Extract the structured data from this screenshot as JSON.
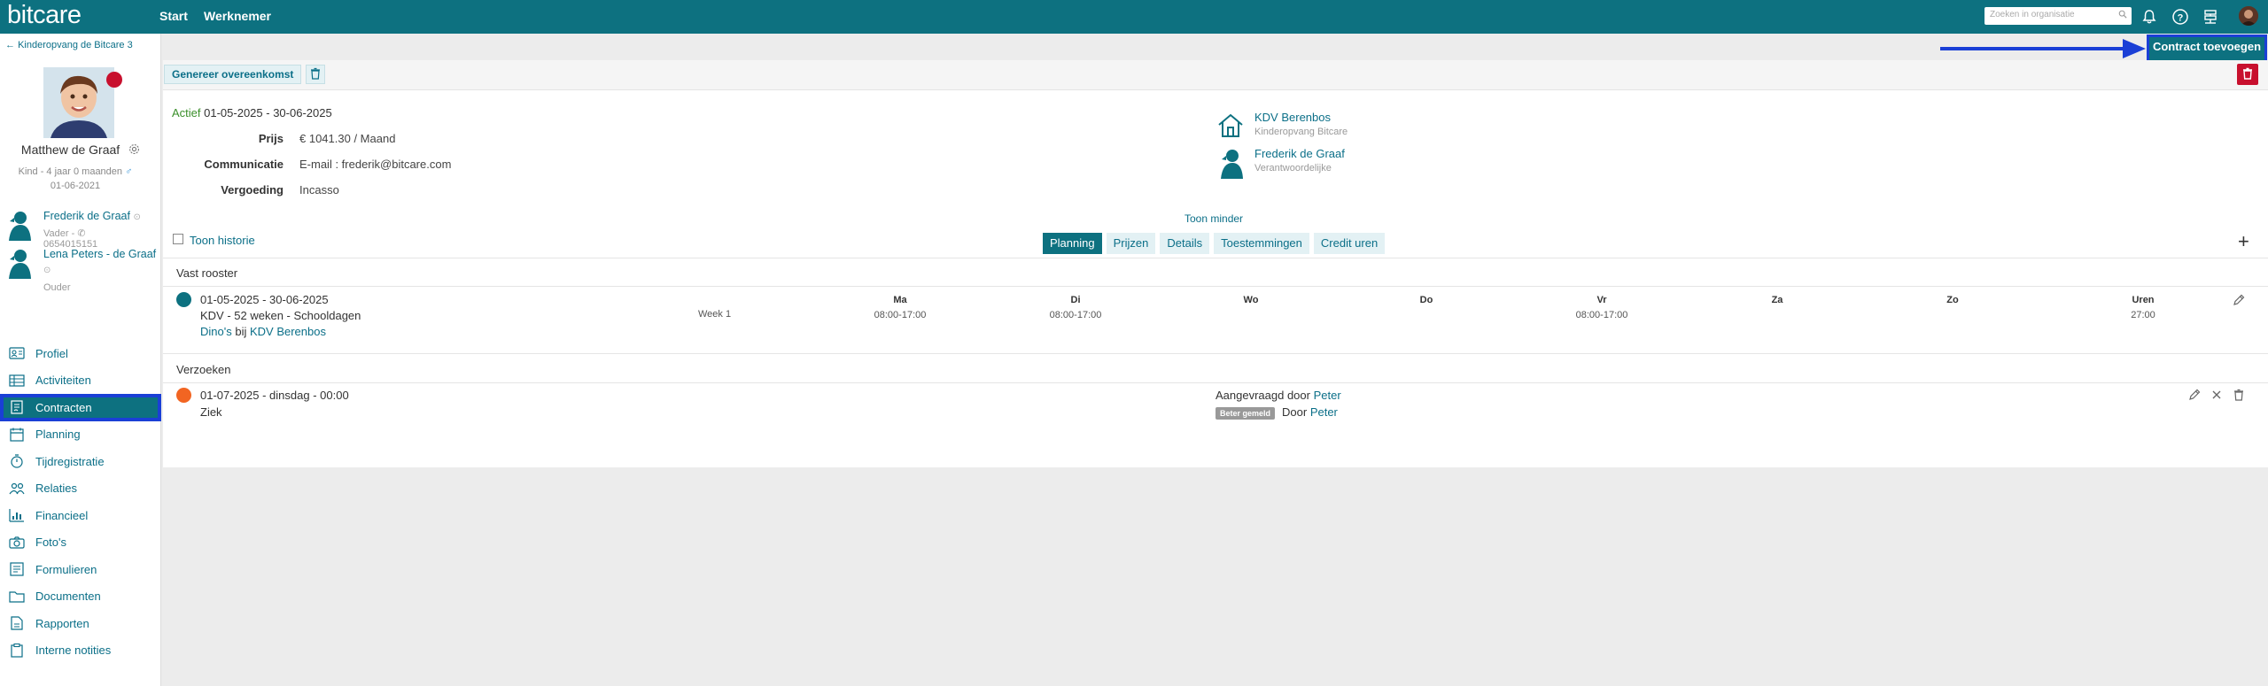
{
  "topbar": {
    "logo": "bitcare",
    "nav": [
      "Start",
      "Werknemer"
    ],
    "search_placeholder": "Zoeken in organisatie"
  },
  "sidebar": {
    "back_link": "Kinderopvang de Bitcare 3",
    "child": {
      "name": "Matthew de Graaf",
      "subtitle": "Kind - 4 jaar 0 maanden",
      "birthdate": "01-06-2021"
    },
    "relations": [
      {
        "name": "Frederik de Graaf",
        "role": "Vader - ",
        "phone": "0654015151"
      },
      {
        "name": "Lena Peters - de Graaf",
        "role": "Ouder",
        "phone": ""
      }
    ],
    "menu": [
      {
        "label": "Profiel",
        "icon": "profile-card-icon",
        "active": false
      },
      {
        "label": "Activiteiten",
        "icon": "table-icon",
        "active": false
      },
      {
        "label": "Contracten",
        "icon": "contract-icon",
        "active": true
      },
      {
        "label": "Planning",
        "icon": "calendar-icon",
        "active": false
      },
      {
        "label": "Tijdregistratie",
        "icon": "stopwatch-icon",
        "active": false
      },
      {
        "label": "Relaties",
        "icon": "people-icon",
        "active": false
      },
      {
        "label": "Financieel",
        "icon": "bar-chart-icon",
        "active": false
      },
      {
        "label": "Foto's",
        "icon": "camera-icon",
        "active": false
      },
      {
        "label": "Formulieren",
        "icon": "form-icon",
        "active": false
      },
      {
        "label": "Documenten",
        "icon": "folder-icon",
        "active": false
      },
      {
        "label": "Rapporten",
        "icon": "report-icon",
        "active": false
      },
      {
        "label": "Interne notities",
        "icon": "clipboard-icon",
        "active": false
      }
    ]
  },
  "actions": {
    "generate_label": "Genereer overeenkomst",
    "add_contract_label": "Contract toevoegen"
  },
  "contract": {
    "status": "Actief",
    "period": "01-05-2025 - 30-06-2025",
    "fields": [
      {
        "key": "Prijs",
        "value": "€ 1041.30 / Maand"
      },
      {
        "key": "Communicatie",
        "value": "E-mail : frederik@bitcare.com"
      },
      {
        "key": "Vergoeding",
        "value": "Incasso"
      }
    ],
    "location": {
      "name": "KDV Berenbos",
      "sub": "Kinderopvang Bitcare"
    },
    "responsible": {
      "name": "Frederik de Graaf",
      "sub": "Verantwoordelijke"
    },
    "toggle_less": "Toon minder"
  },
  "history_toggle": "Toon historie",
  "tabs": [
    {
      "label": "Planning",
      "active": true
    },
    {
      "label": "Prijzen",
      "active": false
    },
    {
      "label": "Details",
      "active": false
    },
    {
      "label": "Toestemmingen",
      "active": false
    },
    {
      "label": "Credit uren",
      "active": false
    }
  ],
  "schedule": {
    "heading": "Vast rooster",
    "color": "#0d7180",
    "period": "01-05-2025 - 30-06-2025",
    "name": "KDV - 52 weken - Schooldagen",
    "group": "Dino's",
    "at": "bij",
    "location": "KDV Berenbos",
    "week": "Week 1",
    "days": [
      {
        "label": "Ma",
        "value": "08:00-17:00"
      },
      {
        "label": "Di",
        "value": "08:00-17:00"
      },
      {
        "label": "Wo",
        "value": ""
      },
      {
        "label": "Do",
        "value": ""
      },
      {
        "label": "Vr",
        "value": "08:00-17:00"
      },
      {
        "label": "Za",
        "value": ""
      },
      {
        "label": "Zo",
        "value": ""
      },
      {
        "label": "Uren",
        "value": "27:00"
      }
    ]
  },
  "requests": {
    "heading": "Verzoeken",
    "color": "#f26522",
    "item": {
      "date": "01-07-2025 - dinsdag - 00:00",
      "type": "Ziek",
      "requested_by_label": "Aangevraagd door",
      "requested_by": "Peter",
      "badge": "Beter gemeld",
      "by_label": "Door",
      "by": "Peter"
    }
  }
}
